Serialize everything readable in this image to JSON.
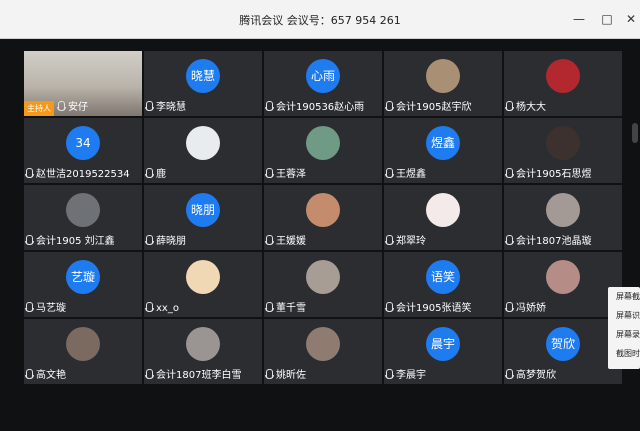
{
  "window": {
    "title": "腾讯会议 会议号：657 954 261",
    "minimize": "—",
    "maximize": "□",
    "close": "✕"
  },
  "host_label": "主持人",
  "participants": [
    {
      "name": "安仔",
      "avatar": "",
      "kind": "video",
      "color": "#b9b3aa"
    },
    {
      "name": "李晓慧",
      "avatar": "晓慧",
      "kind": "text",
      "color": "#1f7cf0"
    },
    {
      "name": "会计190536赵心雨",
      "avatar": "心雨",
      "kind": "text",
      "color": "#1f7cf0"
    },
    {
      "name": "会计1905赵宇欣",
      "avatar": "",
      "kind": "photo",
      "color": "#a99074"
    },
    {
      "name": "杨大大",
      "avatar": "",
      "kind": "photo",
      "color": "#b2282e"
    },
    {
      "name": "赵世洁2019522534",
      "avatar": "34",
      "kind": "text",
      "color": "#1f7cf0"
    },
    {
      "name": "鹿",
      "avatar": "",
      "kind": "photo",
      "color": "#e8ecef"
    },
    {
      "name": "王蓉泽",
      "avatar": "",
      "kind": "photo",
      "color": "#6f9a86"
    },
    {
      "name": "王煜鑫",
      "avatar": "煜鑫",
      "kind": "text",
      "color": "#1f7cf0"
    },
    {
      "name": "会计1905石思煜",
      "avatar": "",
      "kind": "photo",
      "color": "#3d3130"
    },
    {
      "name": "会计1905 刘江鑫",
      "avatar": "",
      "kind": "photo",
      "color": "#6e7276"
    },
    {
      "name": "薛晓朋",
      "avatar": "晓朋",
      "kind": "text",
      "color": "#1f7cf0"
    },
    {
      "name": "王媛媛",
      "avatar": "",
      "kind": "photo",
      "color": "#c58b6d"
    },
    {
      "name": "郑翠玲",
      "avatar": "",
      "kind": "photo",
      "color": "#f4eaea"
    },
    {
      "name": "会计1807池晶璇",
      "avatar": "",
      "kind": "photo",
      "color": "#a49a95"
    },
    {
      "name": "马艺璇",
      "avatar": "艺璇",
      "kind": "text",
      "color": "#1f7cf0"
    },
    {
      "name": "xx_o",
      "avatar": "",
      "kind": "photo",
      "color": "#f0d8b5"
    },
    {
      "name": "董千雪",
      "avatar": "",
      "kind": "photo",
      "color": "#a79d95"
    },
    {
      "name": "会计1905张语笑",
      "avatar": "语笑",
      "kind": "text",
      "color": "#1f7cf0"
    },
    {
      "name": "冯娇娇",
      "avatar": "",
      "kind": "photo",
      "color": "#b68c86"
    },
    {
      "name": "高文艳",
      "avatar": "",
      "kind": "photo",
      "color": "#7a6a5f"
    },
    {
      "name": "会计1807班李白雪",
      "avatar": "",
      "kind": "photo",
      "color": "#9a9492"
    },
    {
      "name": "姚昕佐",
      "avatar": "",
      "kind": "photo",
      "color": "#8f7c70"
    },
    {
      "name": "李晨宇",
      "avatar": "晨宇",
      "kind": "text",
      "color": "#1f7cf0"
    },
    {
      "name": "高梦贺欣",
      "avatar": "贺欣",
      "kind": "text",
      "color": "#1f7cf0"
    }
  ],
  "side_menu": [
    "屏幕截",
    "屏幕识",
    "屏幕录",
    "截图时"
  ]
}
